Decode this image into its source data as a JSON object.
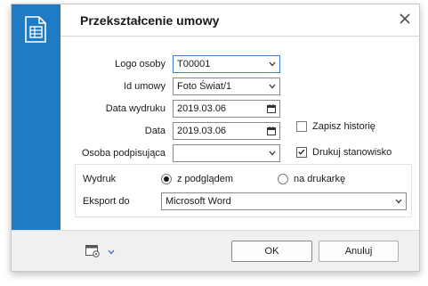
{
  "dialog": {
    "title": "Przekształcenie umowy",
    "accent": "#1f7cc4"
  },
  "form": {
    "logo_osoby": {
      "label": "Logo osoby",
      "value": "T00001"
    },
    "id_umowy": {
      "label": "Id umowy",
      "value": "Foto Świat/1"
    },
    "data_wydruku": {
      "label": "Data wydruku",
      "value": "2019.03.06"
    },
    "data": {
      "label": "Data",
      "value": "2019.03.06"
    },
    "osoba_podpisujaca": {
      "label": "Osoba podpisująca",
      "value": ""
    },
    "zapisz_historie": {
      "label": "Zapisz historię",
      "checked": false
    },
    "drukuj_stanowisko": {
      "label": "Drukuj stanowisko",
      "checked": true
    }
  },
  "print": {
    "wydruk_label": "Wydruk",
    "option_preview": "z podglądem",
    "option_printer": "na drukarkę",
    "selected": "z podglądem",
    "eksport_label": "Eksport do",
    "eksport_value": "Microsoft Word"
  },
  "footer": {
    "ok_label": "OK",
    "cancel_label": "Anuluj"
  },
  "icons": [
    "document-table-icon",
    "close-icon",
    "settings-window-icon",
    "chevron-down-icon",
    "calendar-icon",
    "checkmark-icon"
  ]
}
